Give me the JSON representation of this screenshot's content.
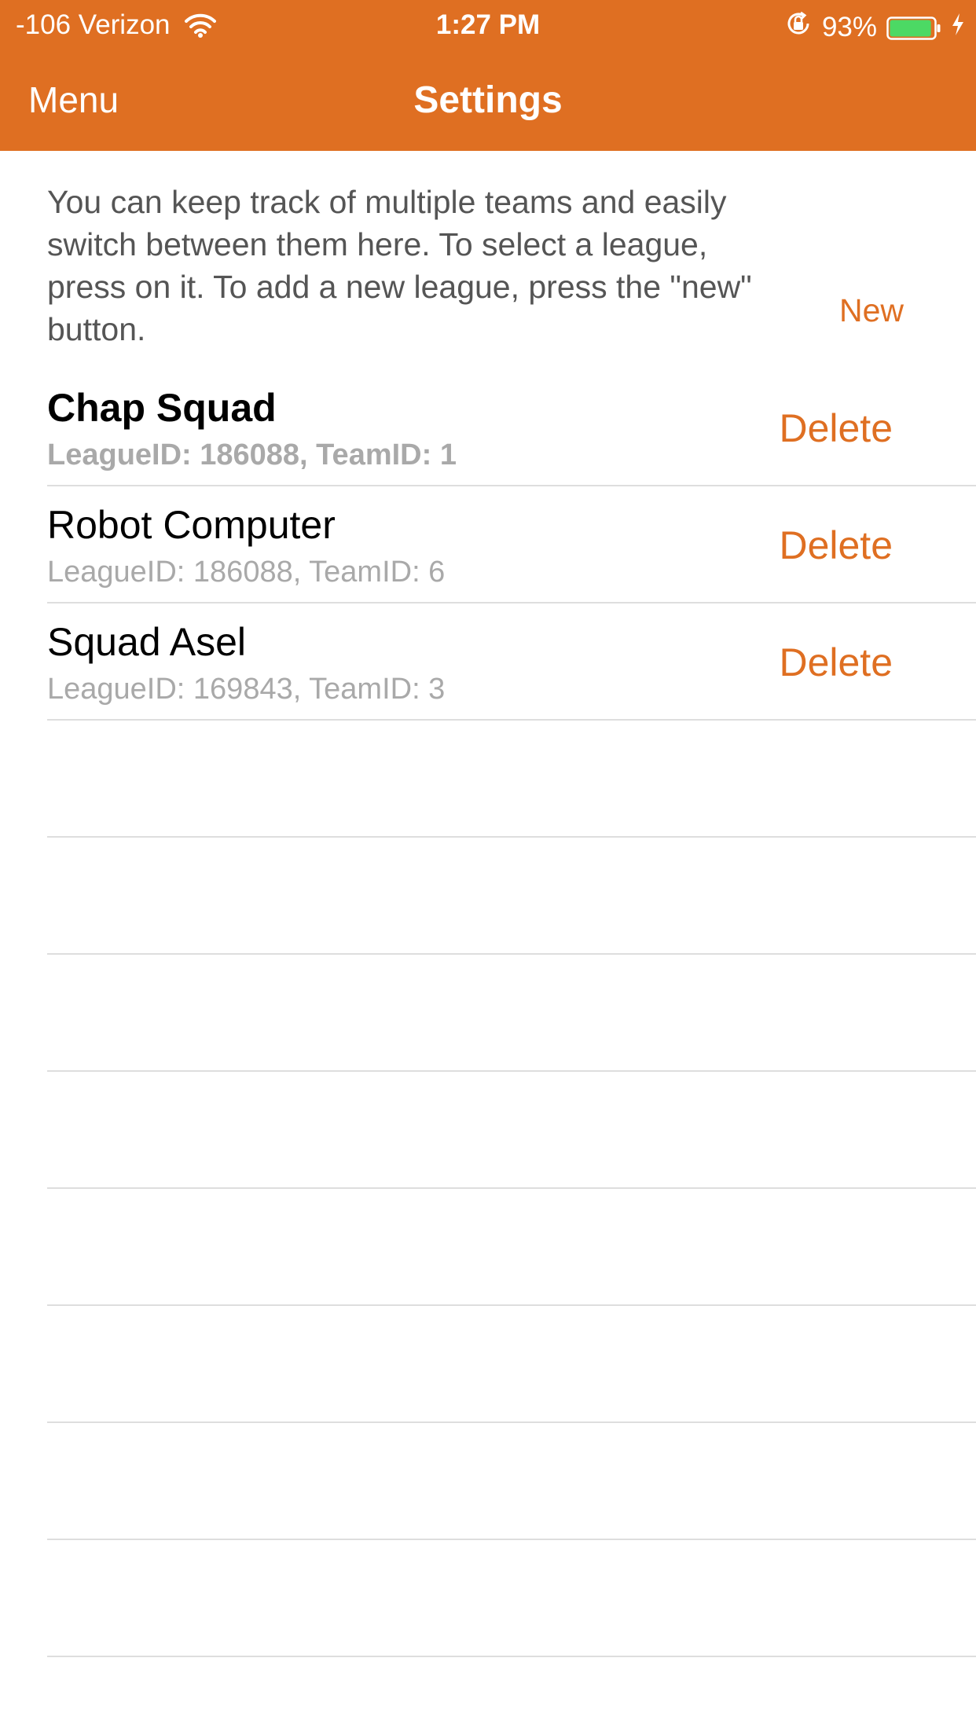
{
  "status_bar": {
    "carrier": "-106 Verizon",
    "time": "1:27 PM",
    "battery_percent": "93%",
    "battery_level": 0.93,
    "battery_color": "#4cd964"
  },
  "nav": {
    "menu_label": "Menu",
    "title": "Settings"
  },
  "intro": {
    "text": "You can keep track of multiple teams and easily switch between them here. To select a league, press on it. To add a new league, press the \"new\" button.",
    "new_label": "New"
  },
  "teams": [
    {
      "name": "Chap Squad",
      "details": "LeagueID: 186088, TeamID: 1",
      "delete_label": "Delete",
      "selected": true
    },
    {
      "name": "Robot Computer",
      "details": "LeagueID: 186088, TeamID: 6",
      "delete_label": "Delete",
      "selected": false
    },
    {
      "name": "Squad Asel",
      "details": "LeagueID: 169843, TeamID: 3",
      "delete_label": "Delete",
      "selected": false
    }
  ],
  "empty_row_count": 8,
  "colors": {
    "accent": "#df6f22",
    "secondary_text": "#a9a9a9",
    "divider": "#dedede"
  }
}
